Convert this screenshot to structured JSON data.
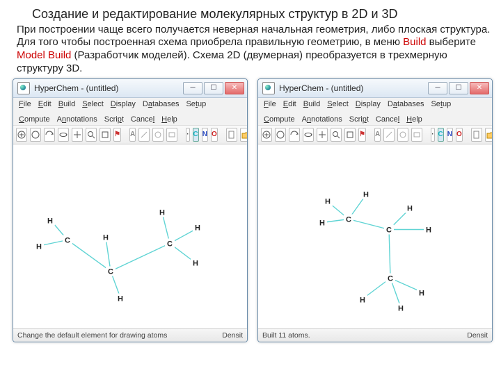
{
  "title": "Создание и редактирование молекулярных структур в 2D и 3D",
  "paragraph": {
    "p1": "При построении чаще всего получается неверная начальная геометрия, либо плоская структура. Для того чтобы построенная схема приобрела правильную геометрию, в меню ",
    "red1": "Build",
    "p2": " выберите ",
    "red2": "Model Build",
    "p3": " (Разработчик моделей). Схема 2D (двумерная) преобразуется в трехмерную структуру 3D."
  },
  "app": {
    "title": "HyperChem - (untitled)",
    "menus": [
      "File",
      "Edit",
      "Build",
      "Select",
      "Display",
      "Databases",
      "Setup",
      "Compute",
      "Annotations",
      "Script",
      "Cancel",
      "Help"
    ]
  },
  "toolbar_atoms": {
    "H": "H",
    "C": "C",
    "N": "N",
    "O": "O"
  },
  "status": {
    "left_text": "Change the default element for drawing atoms",
    "right_text": "Built 11 atoms."
  }
}
